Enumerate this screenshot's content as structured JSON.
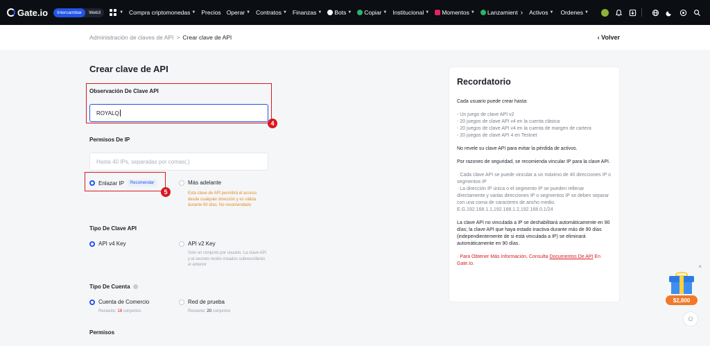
{
  "nav": {
    "brand": "Gate.io",
    "mode_toggle": [
      "Intercambiar",
      "Web3"
    ],
    "items": [
      {
        "label": "Compra criptomonedas",
        "caret": true
      },
      {
        "label": "Precios",
        "caret": false
      },
      {
        "label": "Operar",
        "caret": true
      },
      {
        "label": "Contratos",
        "caret": true
      },
      {
        "label": "Finanzas",
        "caret": true
      },
      {
        "label": "Bots",
        "caret": true
      },
      {
        "label": "Copiar",
        "caret": true
      },
      {
        "label": "Institucional",
        "caret": true
      },
      {
        "label": "Momentos",
        "caret": true
      },
      {
        "label": "Lanzamient",
        "caret": false
      }
    ],
    "more_arrow": "›",
    "right_items": [
      {
        "label": "Activos"
      },
      {
        "label": "Ordenes"
      }
    ]
  },
  "breadcrumb": {
    "parent": "Administración de claves de API",
    "separator": ">",
    "current": "Crear clave de API"
  },
  "back_label": "Volver",
  "form": {
    "title": "Crear clave de API",
    "note_label": "Observación De Clave API",
    "note_value": "ROYALQ",
    "step4": "4",
    "ip_label": "Permisos De IP",
    "ip_placeholder": "Hasta 40 IPs, separadas por comas(,)",
    "bind_ip_label": "Enlazar IP",
    "recommend_tag": "Recomendar",
    "step5": "5",
    "later_label": "Más adelante",
    "later_hint": "Esta clave de API permitirá el acceso desde cualquier dirección y es válida durante 90 días. No recomendado",
    "key_type_label": "Tipo De Clave API",
    "v4_label": "API v4 Key",
    "v2_label": "API v2 Key",
    "v2_hint": "Solo un conjunto por usuario. La clave API y el secreto recién creados sobrescribirán el anterior",
    "account_type_label": "Tipo De Cuenta",
    "trade_account_label": "Cuenta de Comercio",
    "trade_remaining_prefix": "Restante:",
    "trade_remaining": "18",
    "trade_remaining_suffix": "conjuntos",
    "test_label": "Red de prueba",
    "test_remaining_prefix": "Restante:",
    "test_remaining": "20",
    "test_remaining_suffix": "conjuntos",
    "permissions_label": "Permisos"
  },
  "reminder": {
    "title": "Recordatorio",
    "intro": "Cada usuario puede crear hasta:",
    "limits": [
      "- Un juego de clave API v2",
      "- 20 juegos de clave API v4 en la cuenta clásica",
      "- 20 juegos de clave API v4 en la cuenta de margen de cartera",
      "- 20 juegos de clave API 4 en Testnet"
    ],
    "warn_reveal": "No revele su clave API para evitar la pérdida de activos.",
    "security": "Por razones de seguridad, se recomienda vincular IP para la clave API.",
    "ip_note_1": "· Cada clave API se puede vincular a un máximo de 40 direcciones IP o segmentos IP",
    "ip_note_2": "· La dirección IP única o el segmento IP se pueden rellenar directamente y varias direcciones IP o segmentos IP se deben separar con una coma de caracteres de ancho medio. E.G.192.168.1.1,192.168.1.2,192.168.0.1/24",
    "disable_note": "La clave API no vinculada a IP se deshabilitará automáticamente en 90 días; la clave API que haya estado inactiva durante más de 90 días (independientemente de si está vinculada a IP) se eliminará automáticamente en 90 días.",
    "more_prefix": "· Para Obtener Más Información, Consulta ",
    "more_link": "Documentos De API",
    "more_suffix": " En Gate.Io."
  },
  "gift": {
    "price": "$2,800",
    "close": "×"
  },
  "colors": {
    "accent": "#2354e6",
    "annotation_red": "#d7191f",
    "warning": "#e38a1f",
    "nav_bg": "#0b0e13"
  }
}
